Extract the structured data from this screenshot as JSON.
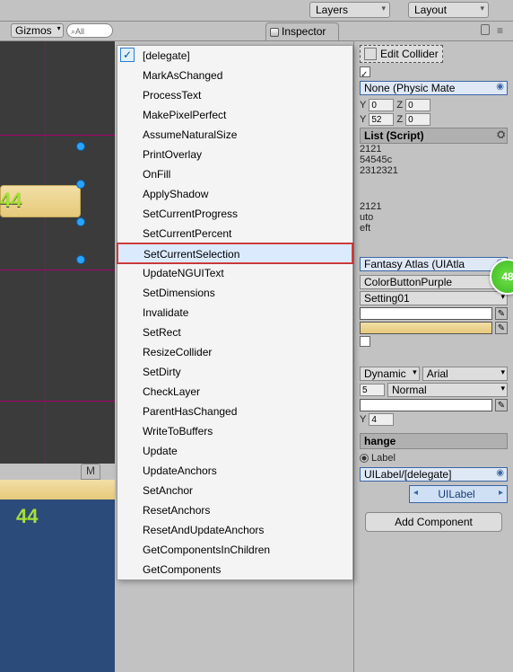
{
  "topbar": {
    "layers": "Layers",
    "layout": "Layout"
  },
  "strip2": {
    "gizmos": "Gizmos",
    "search_placeholder": "All",
    "search_icon": "⌕",
    "inspector_tab": "Inspector"
  },
  "scene": {
    "num": "44"
  },
  "stage": {
    "num": "44"
  },
  "inspector": {
    "edit_collider": "Edit Collider",
    "physic_mat": "None (Physic Mate",
    "y1": "0",
    "z1": "0",
    "y2": "52",
    "z2": "0",
    "list_head": "List (Script)",
    "codes": [
      "2121",
      "54545c",
      "2312321"
    ],
    "val_a": "2121",
    "val_b": "uto",
    "val_c": "eft",
    "atlas": "Fantasy Atlas (UIAtla",
    "sprite_dd": "ColorButtonPurple",
    "setting_dd": "Setting01",
    "font_dd1": "Dynamic",
    "font_dd2": "Arial",
    "font_size": "5",
    "font_style": "Normal",
    "lbl_y": "Y",
    "val_y": "4",
    "change_head": "hange",
    "target_label": "Label",
    "target_path": "UILabel/[delegate]",
    "uilabel_pop": "UILabel",
    "add_component": "Add Component"
  },
  "ctx": {
    "items": [
      "[delegate]",
      "MarkAsChanged",
      "ProcessText",
      "MakePixelPerfect",
      "AssumeNaturalSize",
      "PrintOverlay",
      "OnFill",
      "ApplyShadow",
      "SetCurrentProgress",
      "SetCurrentPercent",
      "SetCurrentSelection",
      "UpdateNGUIText",
      "SetDimensions",
      "Invalidate",
      "SetRect",
      "ResizeCollider",
      "SetDirty",
      "CheckLayer",
      "ParentHasChanged",
      "WriteToBuffers",
      "Update",
      "UpdateAnchors",
      "SetAnchor",
      "ResetAnchors",
      "ResetAndUpdateAnchors",
      "GetComponentsInChildren",
      "GetComponents"
    ],
    "checked_index": 0,
    "selected_index": 10
  },
  "badge": "48"
}
